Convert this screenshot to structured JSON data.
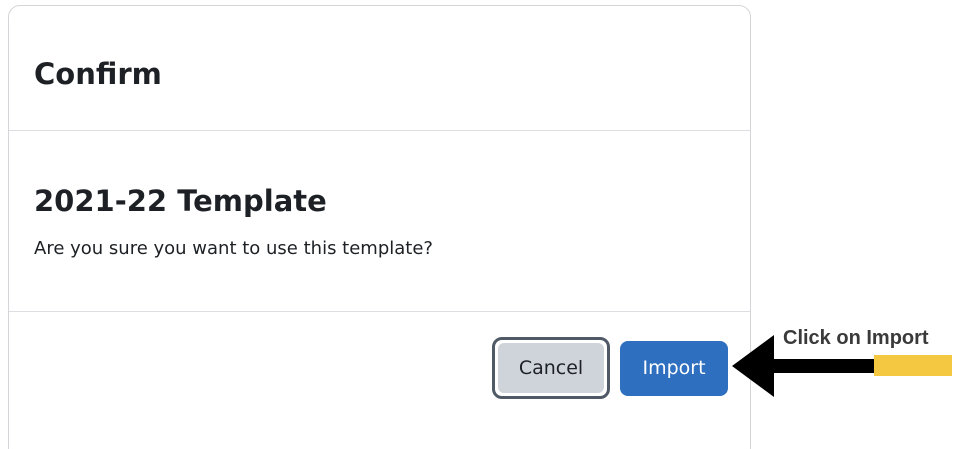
{
  "dialog": {
    "title": "Confirm",
    "template_name": "2021-22 Template",
    "message": "Are you sure you want to use this template?",
    "cancel_label": "Cancel",
    "import_label": "Import"
  },
  "annotation": {
    "label": "Click on Import",
    "arrow_icon": "left-arrow-icon",
    "arrow_color": "#000000",
    "highlight_color": "#f5c842"
  },
  "colors": {
    "primary_button": "#2f6fbf",
    "secondary_button": "#ced4da"
  }
}
